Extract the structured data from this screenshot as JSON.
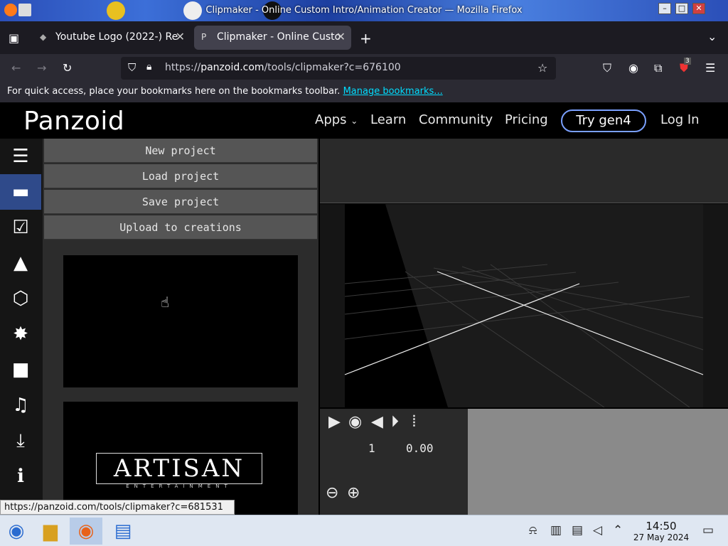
{
  "window": {
    "title": "Clipmaker - Online Custom Intro/Animation Creator — Mozilla Firefox"
  },
  "tabs": [
    {
      "label": "Youtube Logo (2022-) Re",
      "active": false
    },
    {
      "label": "Clipmaker - Online Custo",
      "active": true
    }
  ],
  "navbar": {
    "url_prefix": "https://",
    "url_host": "panzoid.com",
    "url_path": "/tools/clipmaker?c=676100",
    "extensions_badge": "3"
  },
  "bookmarks": {
    "message": "For quick access, place your bookmarks here on the bookmarks toolbar.",
    "link": "Manage bookmarks..."
  },
  "site": {
    "logo": "Panzoid",
    "nav": {
      "apps": "Apps",
      "learn": "Learn",
      "community": "Community",
      "pricing": "Pricing",
      "try": "Try gen4",
      "login": "Log In"
    }
  },
  "menu": {
    "new_project": "New project",
    "load_project": "Load project",
    "save_project": "Save project",
    "upload": "Upload to creations"
  },
  "thumbs": {
    "artisan_title": "ARTISAN",
    "artisan_sub": "ENTERTAINMENT"
  },
  "timeline": {
    "frame": "1",
    "time": "0.00"
  },
  "status_url": "https://panzoid.com/tools/clipmaker?c=681531",
  "clock": {
    "time": "14:50",
    "date": "27 May 2024"
  },
  "colors": {
    "accent": "#2f4a8a",
    "try_border": "#7aa0ff",
    "link": "#00ddff"
  }
}
